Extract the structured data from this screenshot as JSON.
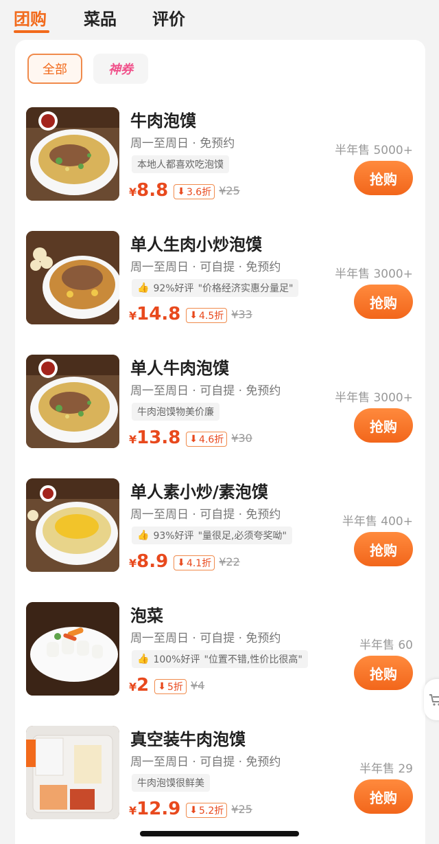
{
  "tabs": [
    {
      "label": "团购",
      "active": true
    },
    {
      "label": "菜品",
      "active": false
    },
    {
      "label": "评价",
      "active": false
    }
  ],
  "filters": {
    "all": "全部",
    "coupon": "神券"
  },
  "colors": {
    "accent": "#f26a1b",
    "price": "#e8491d",
    "coupon": "#f0508a"
  },
  "items": [
    {
      "title": "牛肉泡馍",
      "meta": "周一至周日 · 免预约",
      "tag": "本地人都喜欢吃泡馍",
      "tag_has_thumb": false,
      "price_symbol": "¥",
      "price": "8.8",
      "discount": "3.6折",
      "original": "¥25",
      "sold": "半年售 5000+",
      "buy": "抢购",
      "image": "beef-paomo-bowl"
    },
    {
      "title": "单人生肉小炒泡馍",
      "meta": "周一至周日 · 可自提 · 免预约",
      "tag_rating": "92%好评",
      "tag": "\"价格经济实惠分量足\"",
      "tag_has_thumb": true,
      "price_symbol": "¥",
      "price": "14.8",
      "discount": "4.5折",
      "original": "¥33",
      "sold": "半年售 3000+",
      "buy": "抢购",
      "image": "stir-fry-paomo-bowl"
    },
    {
      "title": "单人牛肉泡馍",
      "meta": "周一至周日 · 可自提 · 免预约",
      "tag": "牛肉泡馍物美价廉",
      "tag_has_thumb": false,
      "price_symbol": "¥",
      "price": "13.8",
      "discount": "4.6折",
      "original": "¥30",
      "sold": "半年售 3000+",
      "buy": "抢购",
      "image": "beef-paomo-bowl"
    },
    {
      "title": "单人素小炒/素泡馍",
      "meta": "周一至周日 · 可自提 · 免预约",
      "tag_rating": "93%好评",
      "tag": "\"量很足,必须夸奖呦\"",
      "tag_has_thumb": true,
      "price_symbol": "¥",
      "price": "8.9",
      "discount": "4.1折",
      "original": "¥22",
      "sold": "半年售 400+",
      "buy": "抢购",
      "image": "veg-paomo-bowl"
    },
    {
      "title": "泡菜",
      "meta": "周一至周日 · 可自提 · 免预约",
      "tag_rating": "100%好评",
      "tag": "\"位置不错,性价比很高\"",
      "tag_has_thumb": true,
      "price_symbol": "¥",
      "price": "2",
      "discount": "5折",
      "original": "¥4",
      "sold": "半年售 60",
      "buy": "抢购",
      "image": "pickle-plate"
    },
    {
      "title": "真空装牛肉泡馍",
      "meta": "周一至周日 · 可自提 · 免预约",
      "tag": "牛肉泡馍很鲜美",
      "tag_has_thumb": false,
      "price_symbol": "¥",
      "price": "12.9",
      "discount": "5.2折",
      "original": "¥25",
      "sold": "半年售 29",
      "buy": "抢购",
      "image": "vacuum-pack"
    }
  ]
}
